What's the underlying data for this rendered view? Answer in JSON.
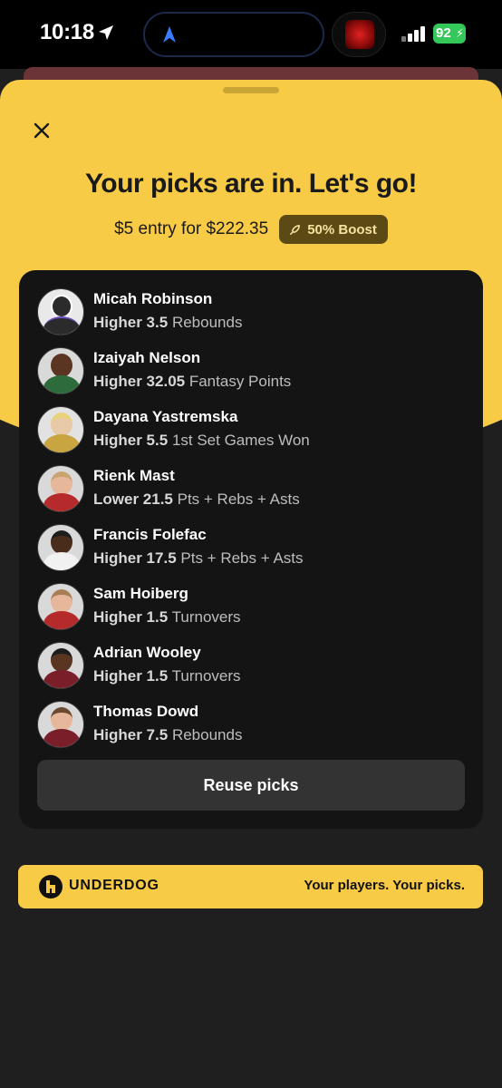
{
  "status_bar": {
    "time": "10:18",
    "battery": "92",
    "icons": [
      "location-arrow-icon",
      "navigation-arrow-icon",
      "album-art",
      "signal-icon",
      "battery-icon"
    ]
  },
  "sheet": {
    "close_icon": "close-icon",
    "title": "Your picks are in. Let's go!",
    "entry_text": "$5 entry for $222.35",
    "boost_label": "50% Boost",
    "boost_icon": "rocket-icon"
  },
  "picks": [
    {
      "name": "Micah Robinson",
      "direction": "Higher 3.5",
      "stat": "Rebounds",
      "avatar": "placeholder"
    },
    {
      "name": "Izaiyah Nelson",
      "direction": "Higher 32.05",
      "stat": "Fantasy Points",
      "avatar": "photo"
    },
    {
      "name": "Dayana Yastremska",
      "direction": "Higher 5.5",
      "stat": "1st Set Games Won",
      "avatar": "photo"
    },
    {
      "name": "Rienk Mast",
      "direction": "Lower 21.5",
      "stat": "Pts + Rebs + Asts",
      "avatar": "photo"
    },
    {
      "name": "Francis Folefac",
      "direction": "Higher 17.5",
      "stat": "Pts + Rebs + Asts",
      "avatar": "photo"
    },
    {
      "name": "Sam Hoiberg",
      "direction": "Higher 1.5",
      "stat": "Turnovers",
      "avatar": "photo"
    },
    {
      "name": "Adrian Wooley",
      "direction": "Higher 1.5",
      "stat": "Turnovers",
      "avatar": "photo"
    },
    {
      "name": "Thomas Dowd",
      "direction": "Higher 7.5",
      "stat": "Rebounds",
      "avatar": "photo"
    }
  ],
  "reuse_button": "Reuse picks",
  "banner": {
    "brand": "UNDERDOG",
    "tagline": "Your players. Your picks.",
    "logo_icon": "underdog-logo-icon"
  },
  "colors": {
    "brand_yellow": "#f7cb46",
    "background": "#1f1f1f",
    "card": "#141414",
    "button": "#333333",
    "boost_badge": "#5b4a14",
    "battery_green": "#34c759"
  }
}
